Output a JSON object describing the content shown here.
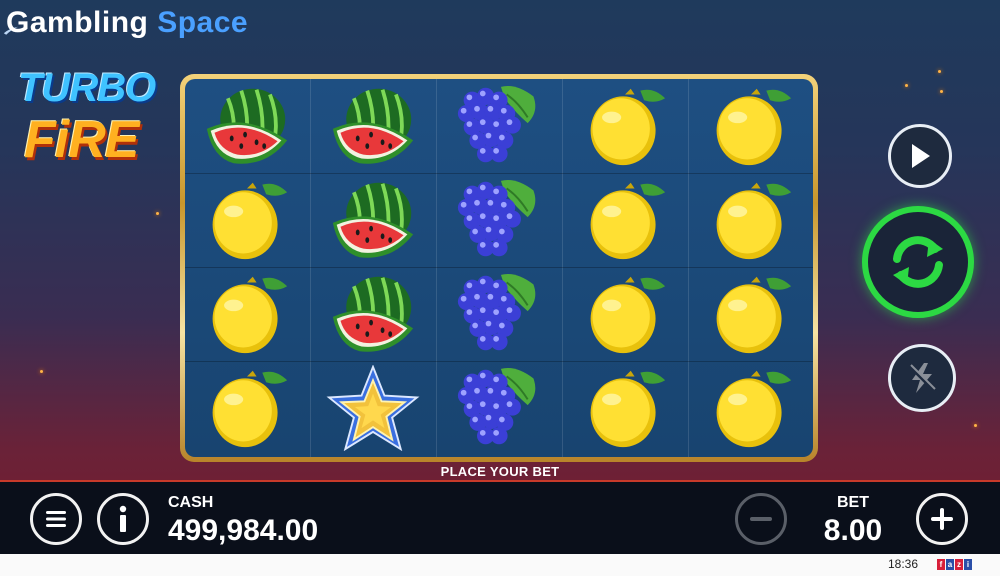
{
  "brand": {
    "word1": "Gambling",
    "word2": "Space"
  },
  "game_logo": {
    "line1": "TURBO",
    "line2": "FiRE"
  },
  "reels": {
    "columns": 5,
    "rows": 4,
    "symbols": [
      [
        "watermelon",
        "watermelon",
        "grapes",
        "lemon",
        "lemon"
      ],
      [
        "lemon",
        "watermelon",
        "grapes",
        "lemon",
        "lemon"
      ],
      [
        "lemon",
        "watermelon",
        "grapes",
        "lemon",
        "lemon"
      ],
      [
        "lemon",
        "star",
        "grapes",
        "lemon",
        "lemon"
      ]
    ]
  },
  "status_message": "PLACE YOUR BET",
  "controls": {
    "play_icon": "play-icon",
    "spin_icon": "refresh-icon",
    "turbo_icon": "lightning-icon",
    "menu_icon": "hamburger-icon",
    "info_icon": "info-icon",
    "minus_icon": "minus-icon",
    "plus_icon": "plus-icon"
  },
  "cash": {
    "label": "CASH",
    "value": "499,984.00"
  },
  "bet": {
    "label": "BET",
    "value": "8.00"
  },
  "system": {
    "clock": "18:36",
    "provider_logo": [
      "f",
      "a",
      "z",
      "i"
    ]
  },
  "colors": {
    "spin_accent": "#2cd943",
    "brand_blue": "#4aa0ff",
    "frame_gold": "#d9ac45"
  }
}
